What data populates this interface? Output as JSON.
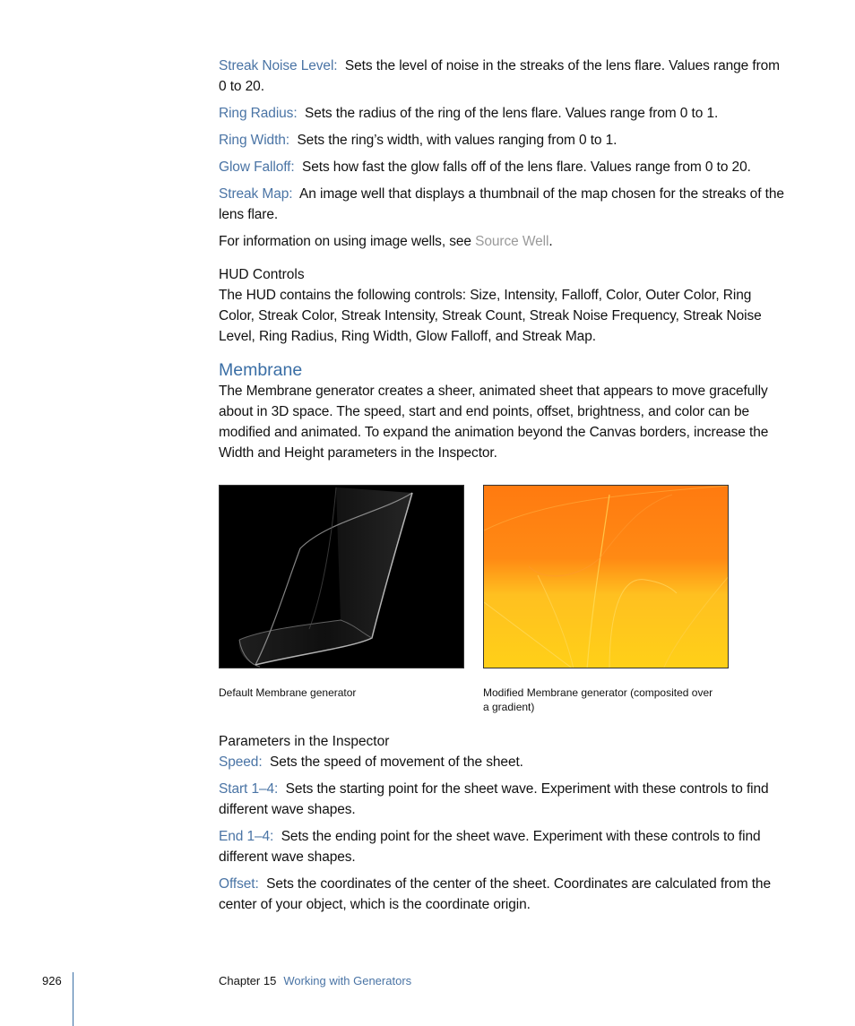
{
  "lens_flare_params": [
    {
      "term": "Streak Noise Level:",
      "text": "Sets the level of noise in the streaks of the lens flare. Values range from 0 to 20."
    },
    {
      "term": "Ring Radius:",
      "text": "Sets the radius of the ring of the lens flare. Values range from 0 to 1."
    },
    {
      "term": "Ring Width:",
      "text": "Sets the ring’s width, with values ranging from 0 to 1."
    },
    {
      "term": "Glow Falloff:",
      "text": "Sets how fast the glow falls off of the lens flare. Values range from 0 to 20."
    },
    {
      "term": "Streak Map:",
      "text": "An image well that displays a thumbnail of the map chosen for the streaks of the lens flare."
    }
  ],
  "image_wells_note": {
    "prefix": "For information on using image wells, see ",
    "link": "Source Well",
    "suffix": "."
  },
  "hud": {
    "heading": "HUD Controls",
    "text": "The HUD contains the following controls: Size, Intensity, Falloff, Color, Outer Color, Ring Color, Streak Color, Streak Intensity, Streak Count, Streak Noise Frequency, Streak Noise Level, Ring Radius, Ring Width, Glow Falloff, and Streak Map."
  },
  "membrane": {
    "heading": "Membrane",
    "text": "The Membrane generator creates a sheer, animated sheet that appears to move gracefully about in 3D space. The speed, start and end points, offset, brightness, and color can be modified and animated. To expand the animation beyond the Canvas borders, increase the Width and Height parameters in the Inspector.",
    "captions": {
      "left": "Default Membrane generator",
      "right": "Modified Membrane generator (composited over a gradient)"
    }
  },
  "inspector": {
    "heading": "Parameters in the Inspector",
    "params": [
      {
        "term": "Speed:",
        "text": "Sets the speed of movement of the sheet."
      },
      {
        "term": "Start 1–4:",
        "text": "Sets the starting point for the sheet wave. Experiment with these controls to find different wave shapes."
      },
      {
        "term": "End 1–4:",
        "text": "Sets the ending point for the sheet wave. Experiment with these controls to find different wave shapes."
      },
      {
        "term": "Offset:",
        "text": "Sets the coordinates of the center of the sheet. Coordinates are calculated from the center of your object, which is the coordinate origin."
      }
    ]
  },
  "footer": {
    "page_number": "926",
    "chapter": "Chapter 15",
    "chapter_title": "Working with Generators"
  },
  "colors": {
    "term": "#4a74a5",
    "heading": "#3a6ea5",
    "link": "#9a9a9a"
  }
}
